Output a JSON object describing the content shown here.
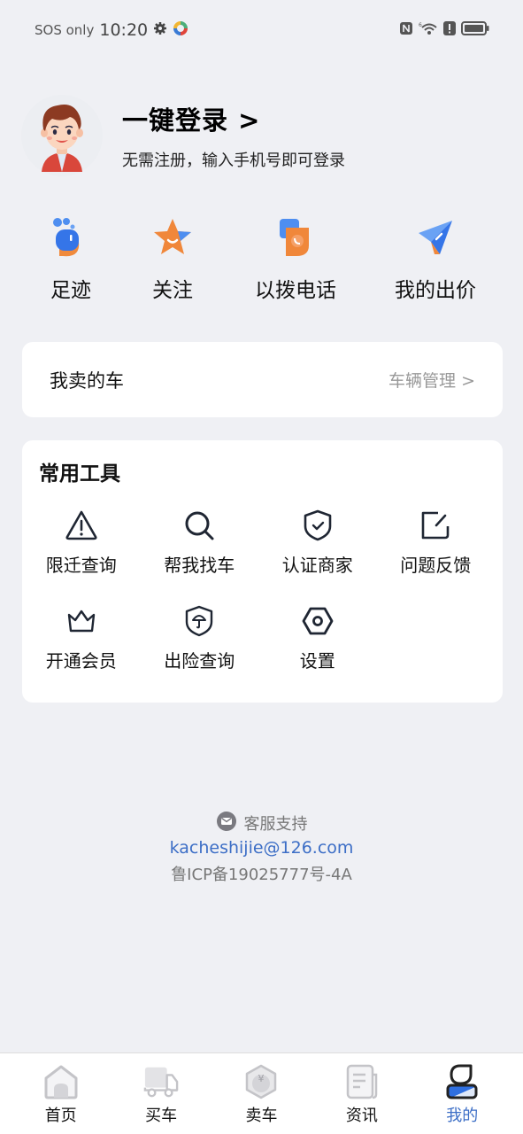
{
  "status_bar": {
    "carrier": "SOS only",
    "time": "10:20",
    "icons": [
      "settings-icon",
      "app-icon",
      "nfc-icon",
      "wifi-icon",
      "alert-icon",
      "battery-icon"
    ]
  },
  "profile": {
    "login_title": "一键登录 >",
    "login_subtitle": "无需注册，输入手机号即可登录"
  },
  "quick_actions": [
    {
      "label": "足迹",
      "icon": "footprint-icon"
    },
    {
      "label": "关注",
      "icon": "star-icon"
    },
    {
      "label": "以拨电话",
      "icon": "phone-icon"
    },
    {
      "label": "我的出价",
      "icon": "send-icon"
    }
  ],
  "sold_cars": {
    "title": "我卖的车",
    "link": "车辆管理 >"
  },
  "tools": {
    "title": "常用工具",
    "items": [
      {
        "label": "限迁查询",
        "icon": "warning-icon"
      },
      {
        "label": "帮我找车",
        "icon": "search-icon"
      },
      {
        "label": "认证商家",
        "icon": "shield-check-icon"
      },
      {
        "label": "问题反馈",
        "icon": "edit-icon"
      },
      {
        "label": "开通会员",
        "icon": "crown-icon"
      },
      {
        "label": "出险查询",
        "icon": "shield-umbrella-icon"
      },
      {
        "label": "设置",
        "icon": "settings-hex-icon"
      }
    ]
  },
  "support": {
    "label": "客服支持",
    "email": "kacheshijie@126.com",
    "icp": "鲁ICP备19025777号-4A"
  },
  "tabbar": {
    "items": [
      {
        "label": "首页",
        "icon": "home-icon",
        "active": false
      },
      {
        "label": "买车",
        "icon": "truck-icon",
        "active": false
      },
      {
        "label": "卖车",
        "icon": "sell-icon",
        "active": false
      },
      {
        "label": "资讯",
        "icon": "news-icon",
        "active": false
      },
      {
        "label": "我的",
        "icon": "profile-icon",
        "active": true
      }
    ],
    "active_color": "#3c6ec6"
  }
}
